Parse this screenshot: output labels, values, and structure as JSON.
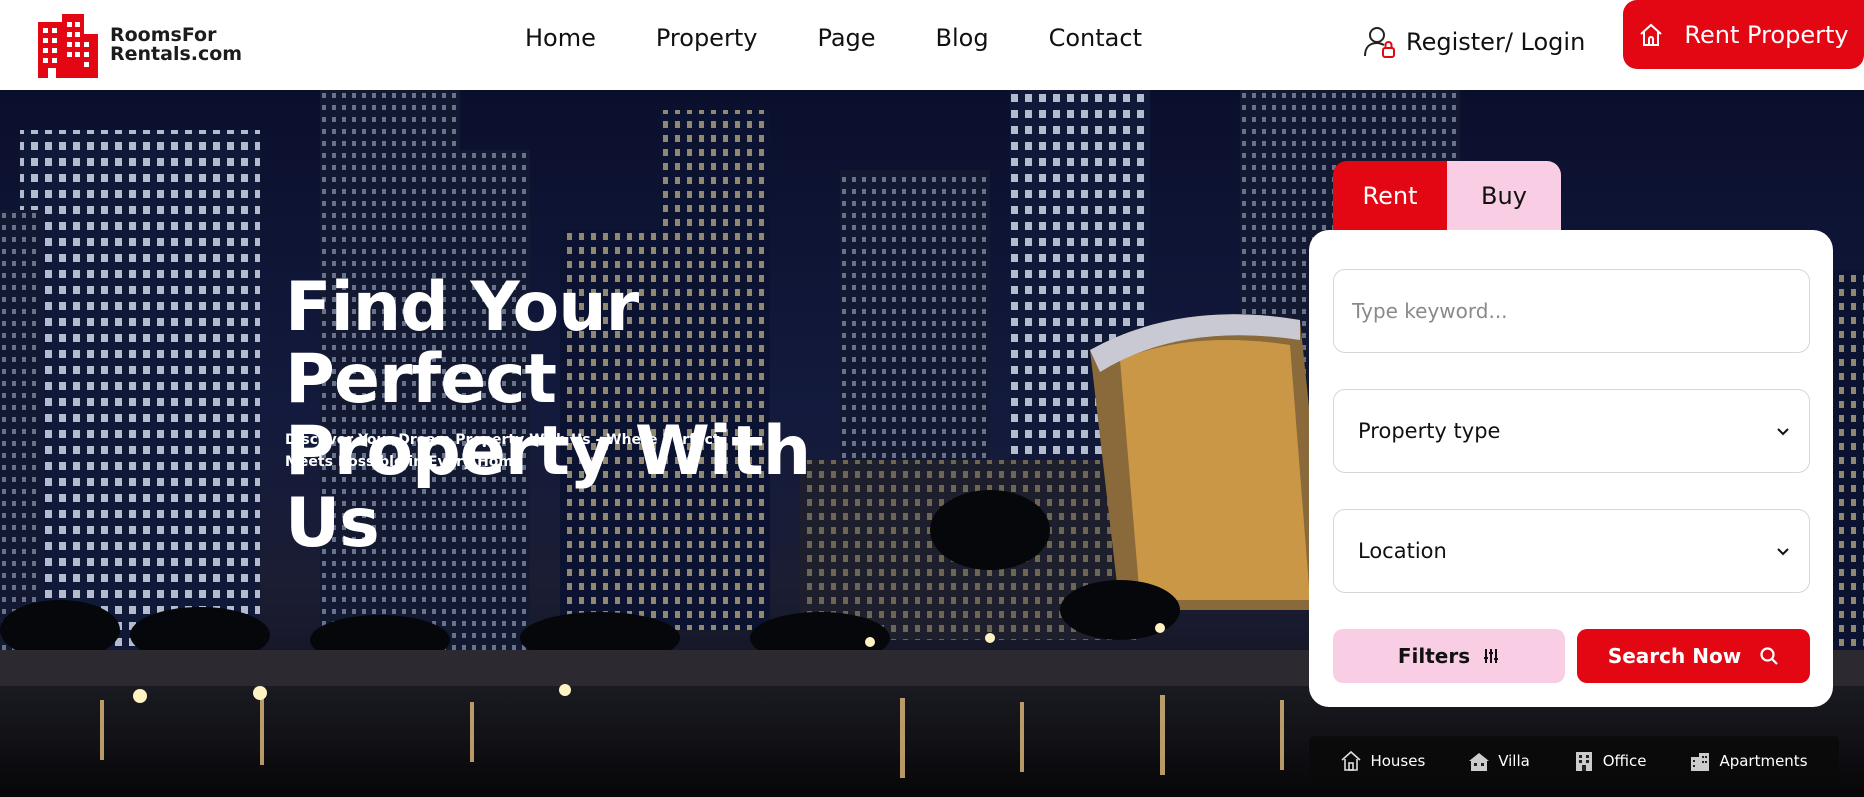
{
  "brand": {
    "line1": "RoomsFor",
    "line2": "Rentals.com",
    "accent": "#e30613"
  },
  "nav": [
    "Home",
    "Property",
    "Page",
    "Blog",
    "Contact"
  ],
  "header": {
    "login_label": "Register/ Login",
    "rent_button": "Rent Property"
  },
  "hero": {
    "title_line1": "Find Your Perfect",
    "title_line2": "Property With Us",
    "subtitle": "Discover Your Dream Property With Us - Where Perfect Meets Possible in Every Home"
  },
  "search": {
    "tabs": [
      "Rent",
      "Buy"
    ],
    "keyword_placeholder": "Type keyword...",
    "property_type": "Property type",
    "location": "Location",
    "filters_label": "Filters",
    "search_label": "Search Now"
  },
  "categories": [
    "Houses",
    "Villa",
    "Office",
    "Apartments"
  ],
  "colors": {
    "accent": "#e30613",
    "pink": "#f9cde3"
  }
}
